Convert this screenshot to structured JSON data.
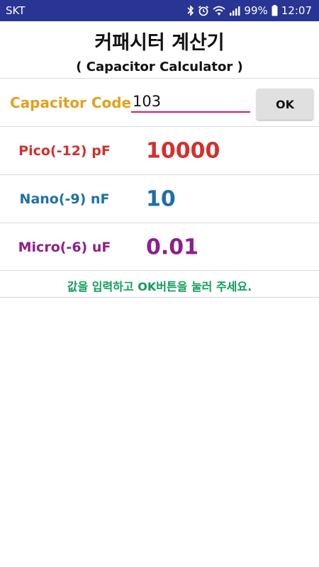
{
  "status_bar": {
    "carrier": "SKT",
    "battery": "99%",
    "time": "12:07",
    "icons": [
      "bluetooth-icon",
      "alarm-icon",
      "wifi-icon",
      "signal-icon",
      "battery-icon"
    ]
  },
  "header": {
    "title": "커패시터 계산기",
    "subtitle": "( Capacitor Calculator )"
  },
  "input": {
    "label": "Capacitor Code",
    "value": "103",
    "ok_label": "OK"
  },
  "results": [
    {
      "label": "Pico(-12) pF",
      "value": "10000",
      "color": "#d32f2f"
    },
    {
      "label": "Nano(-9) nF",
      "value": "10",
      "color": "#1e6fa8"
    },
    {
      "label": "Micro(-6) uF",
      "value": "0.01",
      "color": "#8e1f8a"
    }
  ],
  "hint": "값을 입력하고 OK버튼을 눌러 주세요.",
  "colors": {
    "status_bar": "#283593",
    "code_label": "#e3a01f",
    "input_underline": "#d81b60",
    "hint": "#0f9d58"
  }
}
